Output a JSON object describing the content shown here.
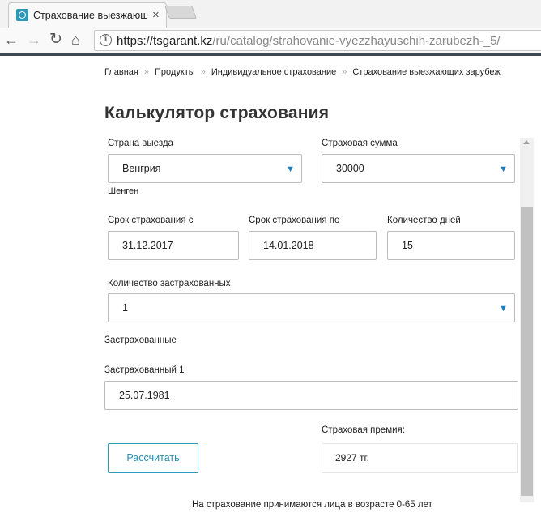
{
  "browser": {
    "tab_title": "Страхование выезжающ",
    "tab_close": "×",
    "url_host": "https://tsgarant.kz",
    "url_path": "/ru/catalog/strahovanie-vyezzhayuschih-zarubezh-_5/",
    "info_icon": "i"
  },
  "breadcrumb": {
    "items": [
      "Главная",
      "Продукты",
      "Индивидуальное страхование",
      "Страхование выезжающих зарубеж"
    ],
    "separator": "»"
  },
  "title": "Калькулятор страхования",
  "form": {
    "country": {
      "label": "Страна выезда",
      "value": "Венгрия",
      "note": "Шенген"
    },
    "sum": {
      "label": "Страховая сумма",
      "value": "30000"
    },
    "date_from": {
      "label": "Срок страхования с",
      "value": "31.12.2017"
    },
    "date_to": {
      "label": "Срок страхования по",
      "value": "14.01.2018"
    },
    "days": {
      "label": "Количество дней",
      "value": "15"
    },
    "insured_count": {
      "label": "Количество застрахованных",
      "value": "1"
    },
    "insured_section": "Застрахованные",
    "insured1": {
      "label": "Застрахованный 1",
      "value": "25.07.1981"
    },
    "premium": {
      "label": "Страховая премия:",
      "value": "2927 тг."
    },
    "calc_button": "Рассчитать"
  },
  "footnote": "На страхование принимаются лица в возрасте 0-65 лет",
  "colors": {
    "accent": "#2a9ab8",
    "select_arrow": "#1a7dbd",
    "border": "#bcbcbc"
  }
}
